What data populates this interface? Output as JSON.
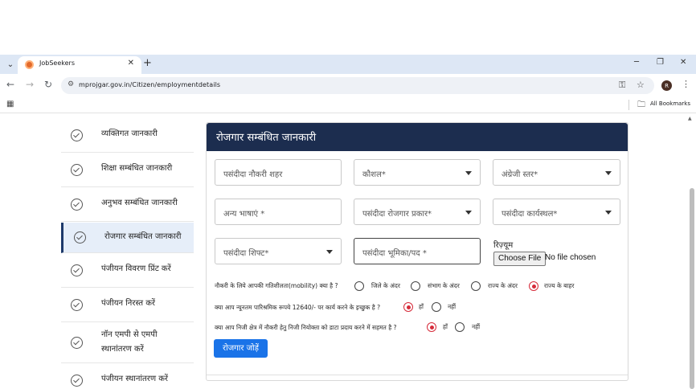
{
  "browser": {
    "tab_title": "JobSeekers",
    "tab_close": "✕",
    "new_tab": "+",
    "url": "mprojgar.gov.in/Citizen/employmentdetails",
    "profile_initial": "R",
    "bookmarks_label": "All Bookmarks",
    "win_minimize": "─",
    "win_restore": "❐",
    "win_close": "✕"
  },
  "sidebar": {
    "items": [
      {
        "label": "व्यक्तिगत जानकारी"
      },
      {
        "label": "शिक्षा सम्बंधित जानकारी"
      },
      {
        "label": "अनुभव सम्बंधित जानकारी"
      },
      {
        "label": "रोजगार सम्बंधित जानकारी"
      },
      {
        "label": "पंजीयन विवरण प्रिंट करें"
      },
      {
        "label": "पंजीयन निरस्त करें"
      },
      {
        "label": "नॉन एमपी से एमपी",
        "label2": "स्थानांतरण करें"
      },
      {
        "label": "पंजीयन स्थानांतरण करें"
      }
    ]
  },
  "form": {
    "title": "रोजगार सम्बंधित जानकारी",
    "preferred_city": "पसंदीदा नौकरी शहर",
    "skill": "कौशल*",
    "english_level": "अंग्रेजी स्तर*",
    "other_languages": "अन्य भाषाएं *",
    "employment_type": "पसंदीदा रोजगार प्रकार*",
    "workplace": "पसंदीदा कार्यस्थल*",
    "shift": "पसंदीदा शिफ्ट*",
    "role": "पसंदीदा भूमिका/पद *",
    "resume_label": "रिज़्यूम",
    "file_button": "Choose File",
    "file_status": "No file chosen",
    "mobility_question": "नौकरी के लिये आपकी गतिशीलता(mobility) क्या है ?",
    "mobility_options": [
      "जिले के अंदर",
      "संभाग के अंदर",
      "राज्य के अंदर",
      "राज्य के बाहर"
    ],
    "mobility_selected": "राज्य के बाहर",
    "salary_question": "क्या आप न्यूनतम पारिश्रमिक रूपये 12640/- पर कार्य करने के इच्छुक है ?",
    "private_question": "क्या आप निजी क्षेत्र में नौकरी हेतु निजी नियोक्ता को डाटा प्रदाय करने में सहमत है ?",
    "yes": "हाँ",
    "no": "नहीं",
    "salary_selected": "हाँ",
    "private_selected": "हाँ",
    "submit_label": "रोजगार जोड़ें"
  }
}
